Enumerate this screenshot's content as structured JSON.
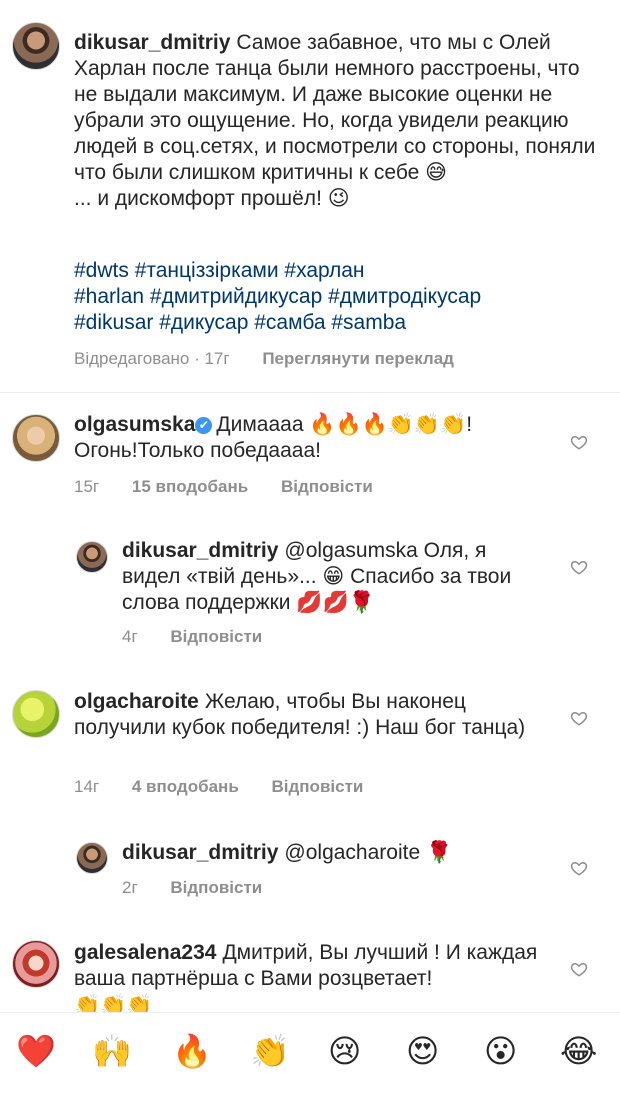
{
  "caption": {
    "username": "dikusar_dmitriy",
    "text": "Самое забавное, что мы с Олей Харлан после танца были немного расстроены, что не выдали максимум. И даже высокие оценки не убрали это ощущение. Но, когда увидели реакцию людей в соц.сетях, и посмотрели со стороны, поняли что были слишком критичны к себе 😅",
    "text2": "... и дискомфорт прошёл! 😉",
    "hashtags_line1": "#dwts #танціззірками #харлан",
    "hashtags_line2": "#harlan #дмитрийдикусар #дмитродікусар",
    "hashtags_line3": "#dikusar #дикусар #самба #samba",
    "edited_time": "Відредаговано · 17г",
    "translate": "Переглянути переклад"
  },
  "comments": [
    {
      "username": "olgasumska",
      "verified_mark": "✔",
      "text": "Димаааа 🔥🔥🔥👏👏👏! Огонь!Только победаааа!",
      "time": "15г",
      "likes": "15 вподобань",
      "reply": "Відповісти"
    },
    {
      "username": "dikusar_dmitriy",
      "text": "@olgasumska Оля, я видел «твій день»... 😁 Спасибо за твои слова поддержки 💋💋🌹",
      "time": "4г",
      "reply": "Відповісти"
    },
    {
      "username": "olgacharoite",
      "text": "Желаю, чтобы Вы наконец получили кубок победителя! :) Наш бог танца)",
      "time": "14г",
      "likes": "4 вподобань",
      "reply": "Відповісти"
    },
    {
      "username": "dikusar_dmitriy",
      "text": "@olgacharoite 🌹",
      "time": "2г",
      "reply": "Відповісти"
    },
    {
      "username": "galesalena234",
      "text": "Дмитрий, Вы лучший ! И каждая ваша партнёрша с Вами розцветает!",
      "text_extra": "👏👏👏"
    }
  ],
  "reactions": [
    "❤️",
    "🙌",
    "🔥",
    "👏",
    "😢",
    "😍",
    "😮",
    "😂"
  ],
  "icons": {
    "like": "heart-outline-icon"
  }
}
